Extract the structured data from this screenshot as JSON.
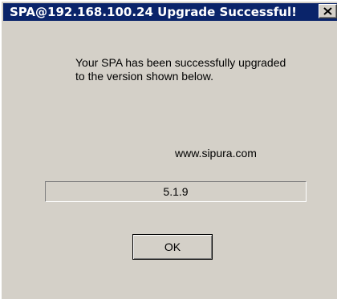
{
  "window": {
    "title": "SPA@192.168.100.24 Upgrade Successful!",
    "close_icon": "close-icon"
  },
  "dialog": {
    "message": "Your SPA has been successfully upgraded to the version shown below.",
    "website": "www.sipura.com",
    "version": "5.1.9",
    "ok_label": "OK"
  },
  "colors": {
    "titlebar": "#0a246a",
    "face": "#d4d0c8"
  }
}
